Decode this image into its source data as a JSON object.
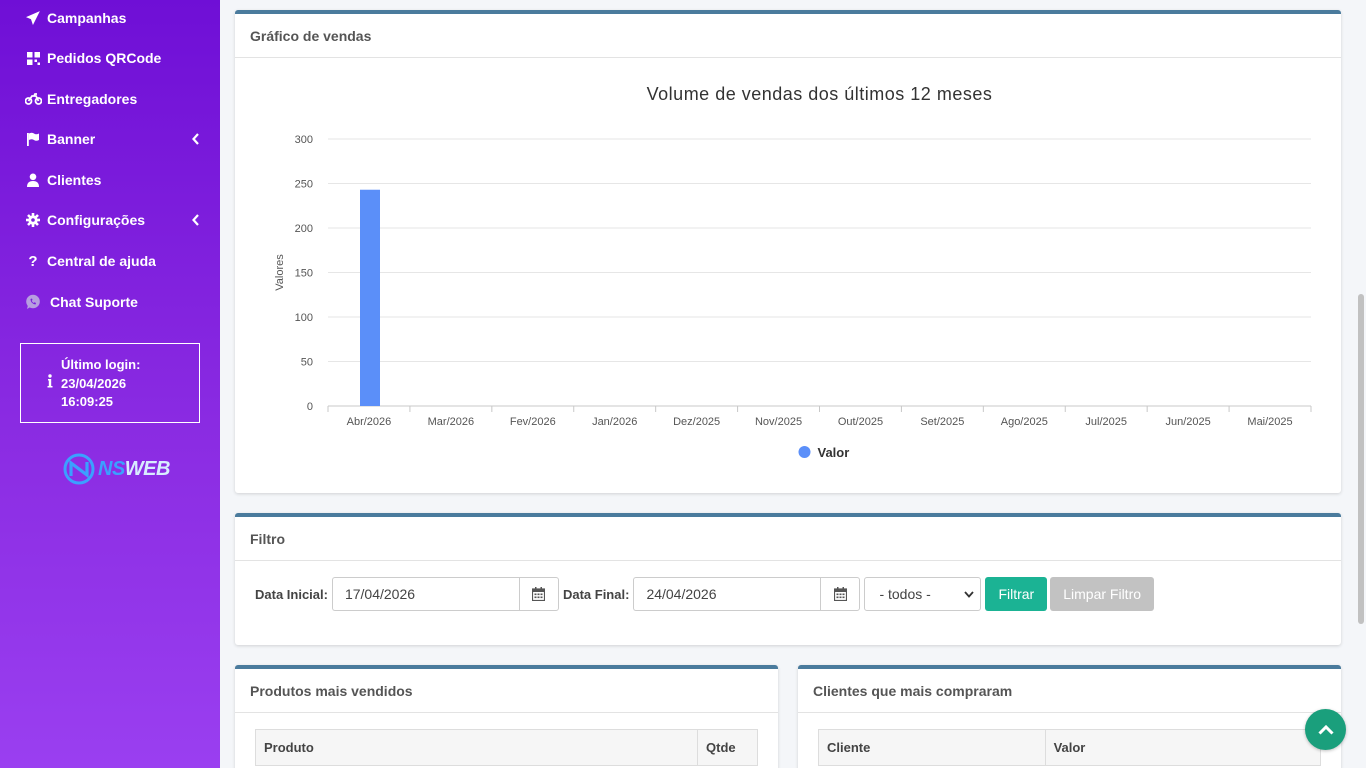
{
  "sidebar": {
    "items": [
      {
        "label": "Campanhas",
        "icon": "paper-plane-icon"
      },
      {
        "label": "Pedidos QRCode",
        "icon": "qrcode-icon"
      },
      {
        "label": "Entregadores",
        "icon": "motorcycle-icon"
      },
      {
        "label": "Banner",
        "icon": "flag-icon",
        "has_submenu": true
      },
      {
        "label": "Clientes",
        "icon": "user-icon"
      },
      {
        "label": "Configurações",
        "icon": "gear-icon",
        "has_submenu": true
      },
      {
        "label": "Central de ajuda",
        "icon": "question-icon"
      },
      {
        "label": "Chat Suporte",
        "icon": "whatsapp-icon"
      }
    ],
    "last_login": {
      "label": "Último login:",
      "date": "23/04/2026",
      "time": "16:09:25"
    },
    "logo": {
      "ns": "NS",
      "web": "WEB"
    }
  },
  "sales_chart_card": {
    "title": "Gráfico de vendas"
  },
  "chart_data": {
    "type": "bar",
    "title": "Volume de vendas dos últimos 12 meses",
    "ylabel": "Valores",
    "xlabel": "",
    "categories": [
      "Abr/2026",
      "Mar/2026",
      "Fev/2026",
      "Jan/2026",
      "Dez/2025",
      "Nov/2025",
      "Out/2025",
      "Set/2025",
      "Ago/2025",
      "Jul/2025",
      "Jun/2025",
      "Mai/2025"
    ],
    "series": [
      {
        "name": "Valor",
        "values": [
          243,
          0,
          0,
          0,
          0,
          0,
          0,
          0,
          0,
          0,
          0,
          0
        ],
        "color": "#5b8ff9"
      }
    ],
    "ylim": [
      0,
      300
    ],
    "yticks": [
      0,
      50,
      100,
      150,
      200,
      250,
      300
    ],
    "grid": true,
    "legend_position": "bottom"
  },
  "filter_card": {
    "title": "Filtro",
    "start_label": "Data Inicial:",
    "start_value": "17/04/2026",
    "end_label": "Data Final:",
    "end_value": "24/04/2026",
    "select_value": "- todos -",
    "filter_button": "Filtrar",
    "clear_button": "Limpar Filtro"
  },
  "top_products_card": {
    "title": "Produtos mais vendidos",
    "columns": [
      "Produto",
      "Qtde"
    ]
  },
  "top_clients_card": {
    "title": "Clientes que mais compraram",
    "columns": [
      "Cliente",
      "Valor"
    ]
  },
  "colors": {
    "sidebar_top": "#6f0fd6",
    "sidebar_bottom": "#9a3ff0",
    "card_border": "#4a7b9d",
    "filter_button": "#1bb394",
    "clear_button": "#c2c2c2",
    "bar": "#5b8ff9",
    "back_to_top": "#1a9f7c"
  }
}
